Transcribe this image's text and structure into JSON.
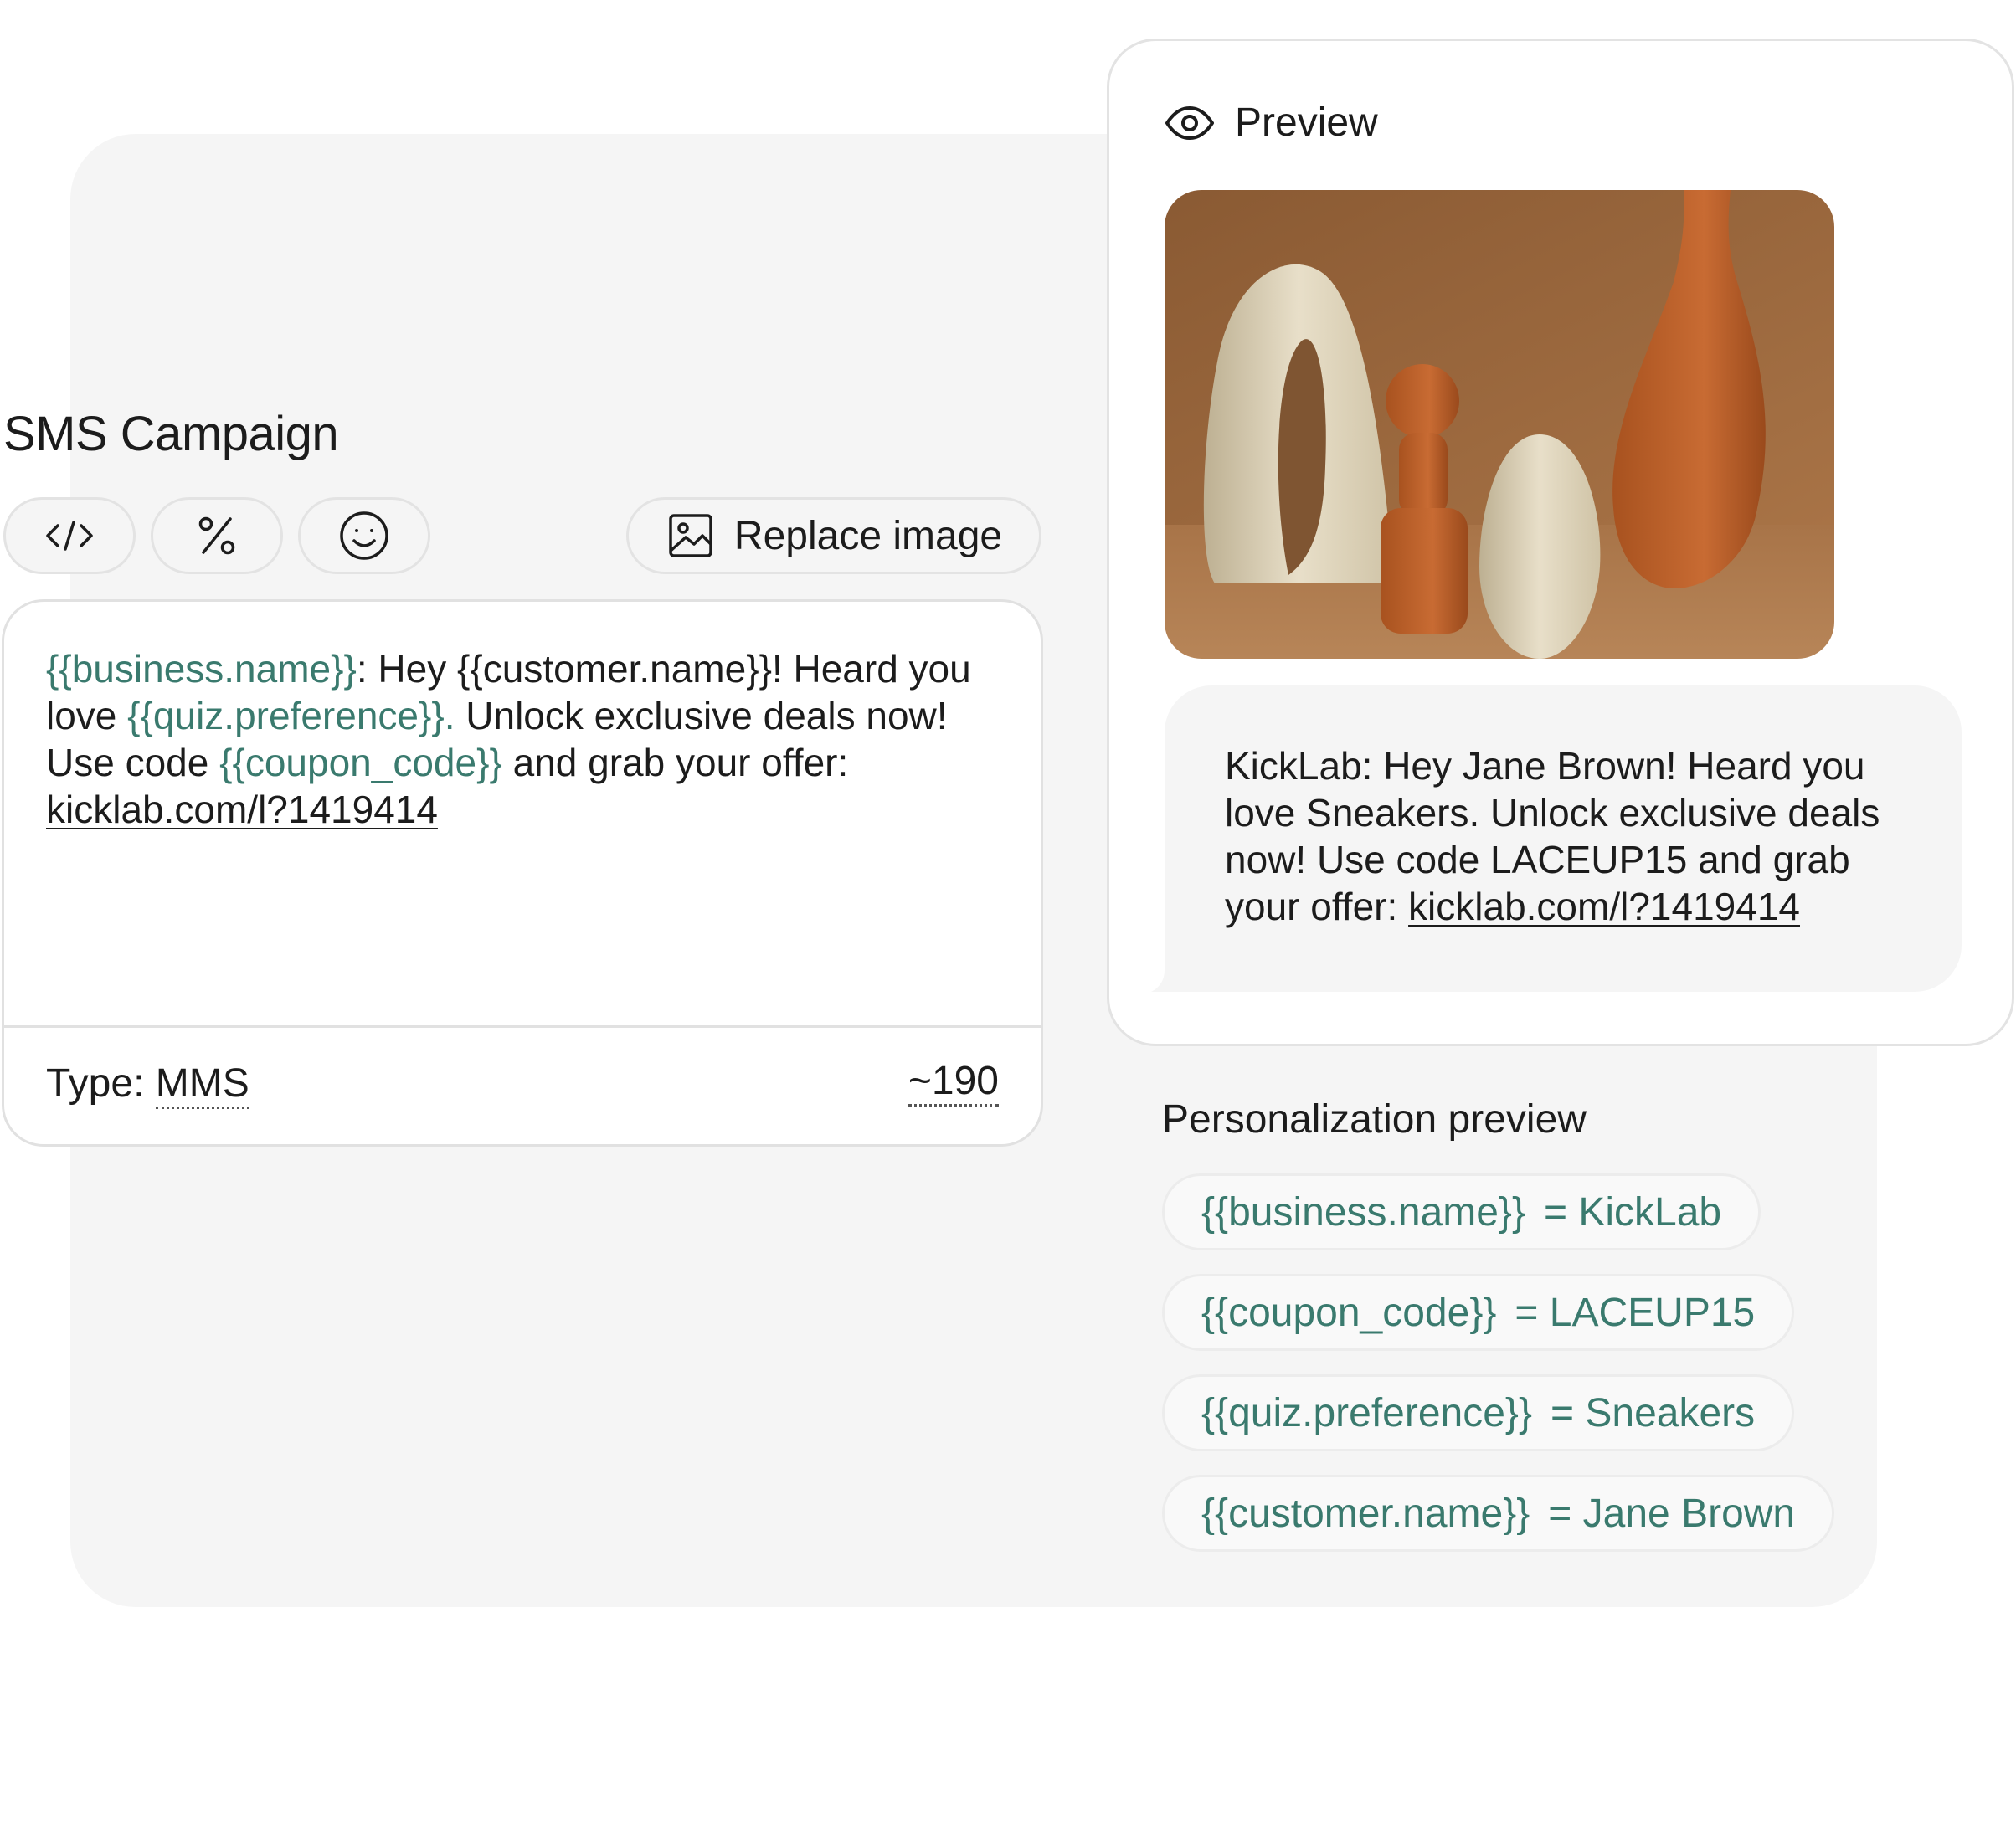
{
  "composer": {
    "title": "SMS Campaign",
    "toolbar": {
      "code_icon": "code-icon",
      "percent_icon": "percent-icon",
      "emoji_icon": "smile-icon",
      "replace_image_label": "Replace image"
    },
    "message": {
      "var_business": "{{business.name}}",
      "t1": ": Hey {{customer.name}}! Heard you love ",
      "var_quiz": "{{quiz.preference}}.",
      "t2": " Unlock exclusive deals now! Use code ",
      "var_coupon": "{{coupon_code}}",
      "t3": " and grab your offer: ",
      "link": "kicklab.com/l?1419414"
    },
    "footer": {
      "type_prefix": "Type: ",
      "type_value": "MMS",
      "char_count": "~190"
    }
  },
  "preview": {
    "title": "Preview",
    "message_text": "KickLab: Hey Jane Brown! Heard you love Sneakers. Unlock exclusive deals now! Use code LACEUP15 and grab your offer: ",
    "message_link": "kicklab.com/l?1419414"
  },
  "personalization": {
    "title": "Personalization preview",
    "items": [
      {
        "key": "{{business.name}}",
        "value": "= KickLab"
      },
      {
        "key": "{{coupon_code}}",
        "value": "= LACEUP15"
      },
      {
        "key": "{{quiz.preference}}",
        "value": "= Sneakers"
      },
      {
        "key": "{{customer.name}}",
        "value": "= Jane Brown"
      }
    ]
  },
  "colors": {
    "accent_variable": "#3a7a6e",
    "panel_bg": "#f5f5f5",
    "text": "#1c1c1c"
  }
}
